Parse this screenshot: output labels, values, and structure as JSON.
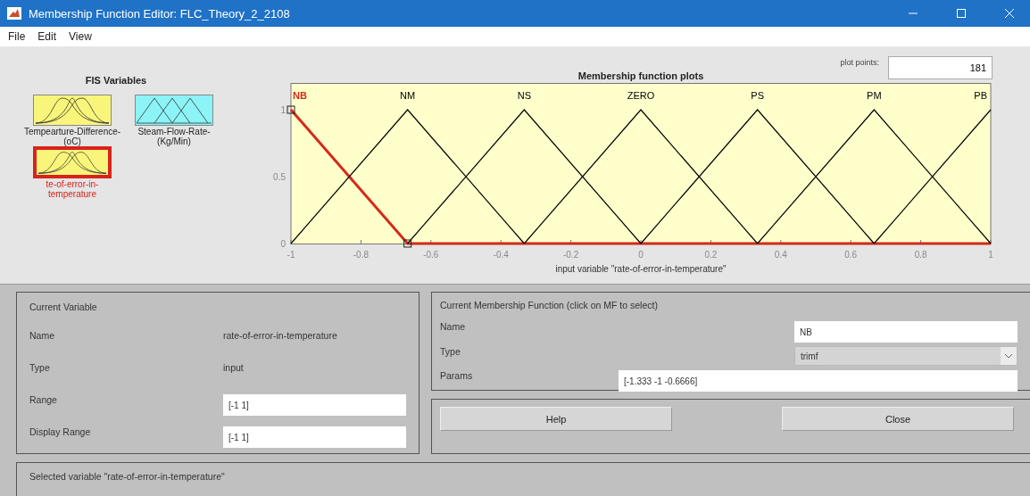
{
  "window": {
    "title": "Membership Function Editor: FLC_Theory_2_2108"
  },
  "menu": [
    "File",
    "Edit",
    "View"
  ],
  "fis_variables": {
    "title": "FIS Variables",
    "variables": [
      {
        "name": "Tempearture-Difference-(oC)",
        "kind": "input",
        "selected": false
      },
      {
        "name": "Steam-Flow-Rate-(Kg/Min)",
        "kind": "output",
        "selected": false
      },
      {
        "name": "te-of-error-in-temperature",
        "kind": "input",
        "selected": true
      }
    ]
  },
  "plot": {
    "title": "Membership function plots",
    "plot_points_label": "plot points:",
    "plot_points": "181",
    "chart_data": {
      "type": "line",
      "xlabel": "input variable \"rate-of-error-in-temperature\"",
      "x": [
        -1,
        -0.6667,
        -0.3333,
        0,
        0.3333,
        0.6667,
        1
      ],
      "series": [
        {
          "name": "NB",
          "color": "#d42a1a",
          "values": [
            1,
            0,
            0,
            0,
            0,
            0,
            0
          ]
        },
        {
          "name": "NM",
          "color": "#000000",
          "values": [
            0,
            1,
            0,
            null,
            null,
            null,
            null
          ]
        },
        {
          "name": "NS",
          "color": "#000000",
          "values": [
            null,
            0,
            1,
            0,
            null,
            null,
            null
          ]
        },
        {
          "name": "ZERO",
          "color": "#000000",
          "values": [
            null,
            null,
            0,
            1,
            0,
            null,
            null
          ]
        },
        {
          "name": "PS",
          "color": "#000000",
          "values": [
            null,
            null,
            null,
            0,
            1,
            0,
            null
          ]
        },
        {
          "name": "PM",
          "color": "#000000",
          "values": [
            null,
            null,
            null,
            null,
            0,
            1,
            0
          ]
        },
        {
          "name": "PB",
          "color": "#000000",
          "values": [
            null,
            null,
            null,
            null,
            null,
            0,
            1
          ]
        }
      ],
      "xlim": [
        -1,
        1
      ],
      "ylim": [
        0,
        1.2
      ],
      "xticks": [
        -1,
        -0.8,
        -0.6,
        -0.4,
        -0.2,
        0,
        0.2,
        0.4,
        0.6,
        0.8,
        1
      ],
      "yticks": [
        0,
        0.5,
        1
      ]
    }
  },
  "current_variable": {
    "title": "Current Variable",
    "name_label": "Name",
    "name": "rate-of-error-in-temperature",
    "type_label": "Type",
    "type": "input",
    "range_label": "Range",
    "range": "[-1 1]",
    "display_range_label": "Display Range",
    "display_range": "[-1 1]"
  },
  "current_mf": {
    "title": "Current Membership Function (click on MF to select)",
    "name_label": "Name",
    "name": "NB",
    "type_label": "Type",
    "type": "trimf",
    "params_label": "Params",
    "params": "[-1.333 -1 -0.6666]"
  },
  "buttons": [
    "Help",
    "Close"
  ],
  "status": "Selected variable \"rate-of-error-in-temperature\""
}
